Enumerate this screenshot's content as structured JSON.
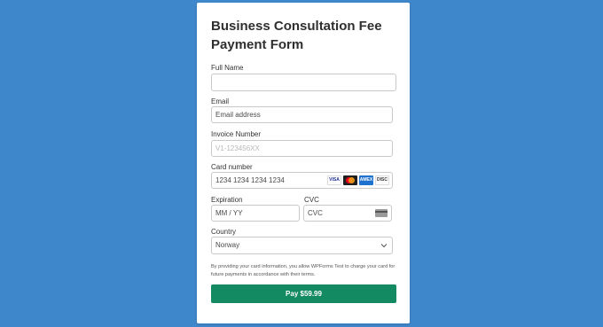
{
  "form": {
    "title": "Business Consultation Fee Payment Form",
    "full_name": {
      "label": "Full Name",
      "value": ""
    },
    "email": {
      "label": "Email",
      "placeholder": "Email address"
    },
    "invoice": {
      "label": "Invoice Number",
      "placeholder": "V1-123456XX"
    },
    "card": {
      "label": "Card number",
      "placeholder": "1234 1234 1234 1234",
      "brands": [
        "VISA",
        "mastercard",
        "AMEX",
        "DISC"
      ]
    },
    "expiration": {
      "label": "Expiration",
      "placeholder": "MM / YY"
    },
    "cvc": {
      "label": "CVC",
      "placeholder": "CVC"
    },
    "country": {
      "label": "Country",
      "value": "Norway"
    },
    "terms": "By providing your card information, you allow WPForms Test to charge your card for future payments in accordance with their terms.",
    "pay_label": "Pay $59.99"
  },
  "colors": {
    "background": "#3f87cb",
    "button": "#148a63"
  }
}
